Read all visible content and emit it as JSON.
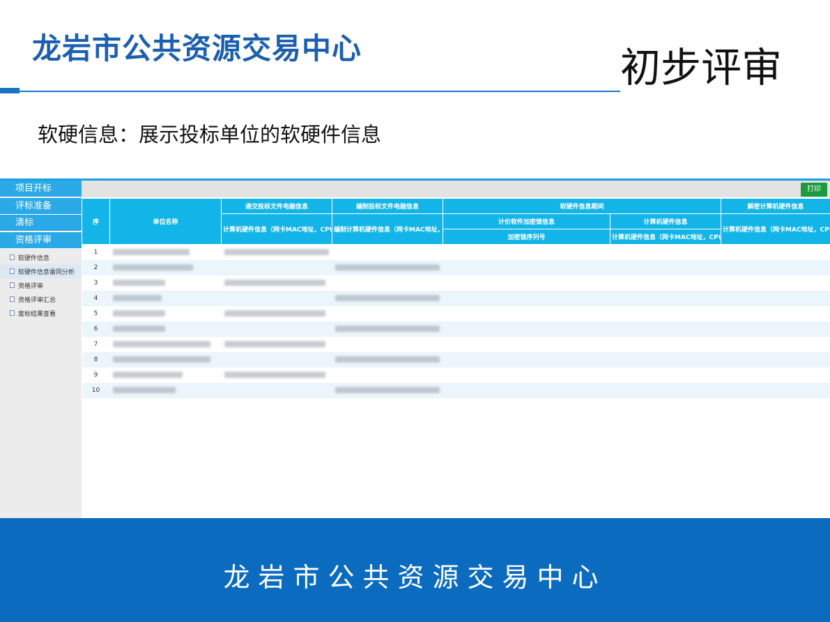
{
  "header": {
    "org_title": "龙岩市公共资源交易中心",
    "slide_title": "初步评审",
    "subtitle": "软硬信息：展示投标单位的软硬件信息"
  },
  "sidebar": {
    "menu": [
      {
        "label": "项目开标"
      },
      {
        "label": "评标准备"
      },
      {
        "label": "清标"
      },
      {
        "label": "资格评审"
      }
    ],
    "sub_items": [
      {
        "label": "软硬件信息"
      },
      {
        "label": "软硬件信息雷同分析"
      },
      {
        "label": "资格评审"
      },
      {
        "label": "资格评审汇总"
      },
      {
        "label": "废标结果查看"
      }
    ],
    "active_sub_index": 1
  },
  "toolbar": {
    "print_label": "打印"
  },
  "table": {
    "seq_header": "序",
    "name_header": "单位名称",
    "group_headers": [
      "递交投标文件电脑信息",
      "编制投标文件电脑信息",
      "软硬件信息期间",
      "解密计算机硬件信息"
    ],
    "sub_headers": {
      "submit_hw": "计算机硬件信息（网卡MAC地址，CPU序列",
      "compile_hw": "编制计算机硬件信息（网卡MAC地址，CPU",
      "pricing_sw": "计价软件加密锁信息",
      "pricing_hw": "计算机硬件信息",
      "lock_serial": "加密锁序列号",
      "pricing_hw_detail": "计算机硬件信息（网卡MAC地址，CPU序列",
      "decrypt_hw": "计算机硬件信息（网卡MAC地址，CPU序列"
    },
    "rows": [
      {
        "seq": "1"
      },
      {
        "seq": "2"
      },
      {
        "seq": "3"
      },
      {
        "seq": "4"
      },
      {
        "seq": "5"
      },
      {
        "seq": "6"
      },
      {
        "seq": "7"
      },
      {
        "seq": "8"
      },
      {
        "seq": "9"
      },
      {
        "seq": "10"
      }
    ]
  },
  "footer": {
    "text": "龙岩市公共资源交易中心"
  },
  "colors": {
    "brand_blue": "#1b5fae",
    "sidebar_blue": "#2ba9e6",
    "header_cyan": "#13b5e8",
    "print_green": "#1d9a3d",
    "footer_blue": "#0b6bbf"
  }
}
